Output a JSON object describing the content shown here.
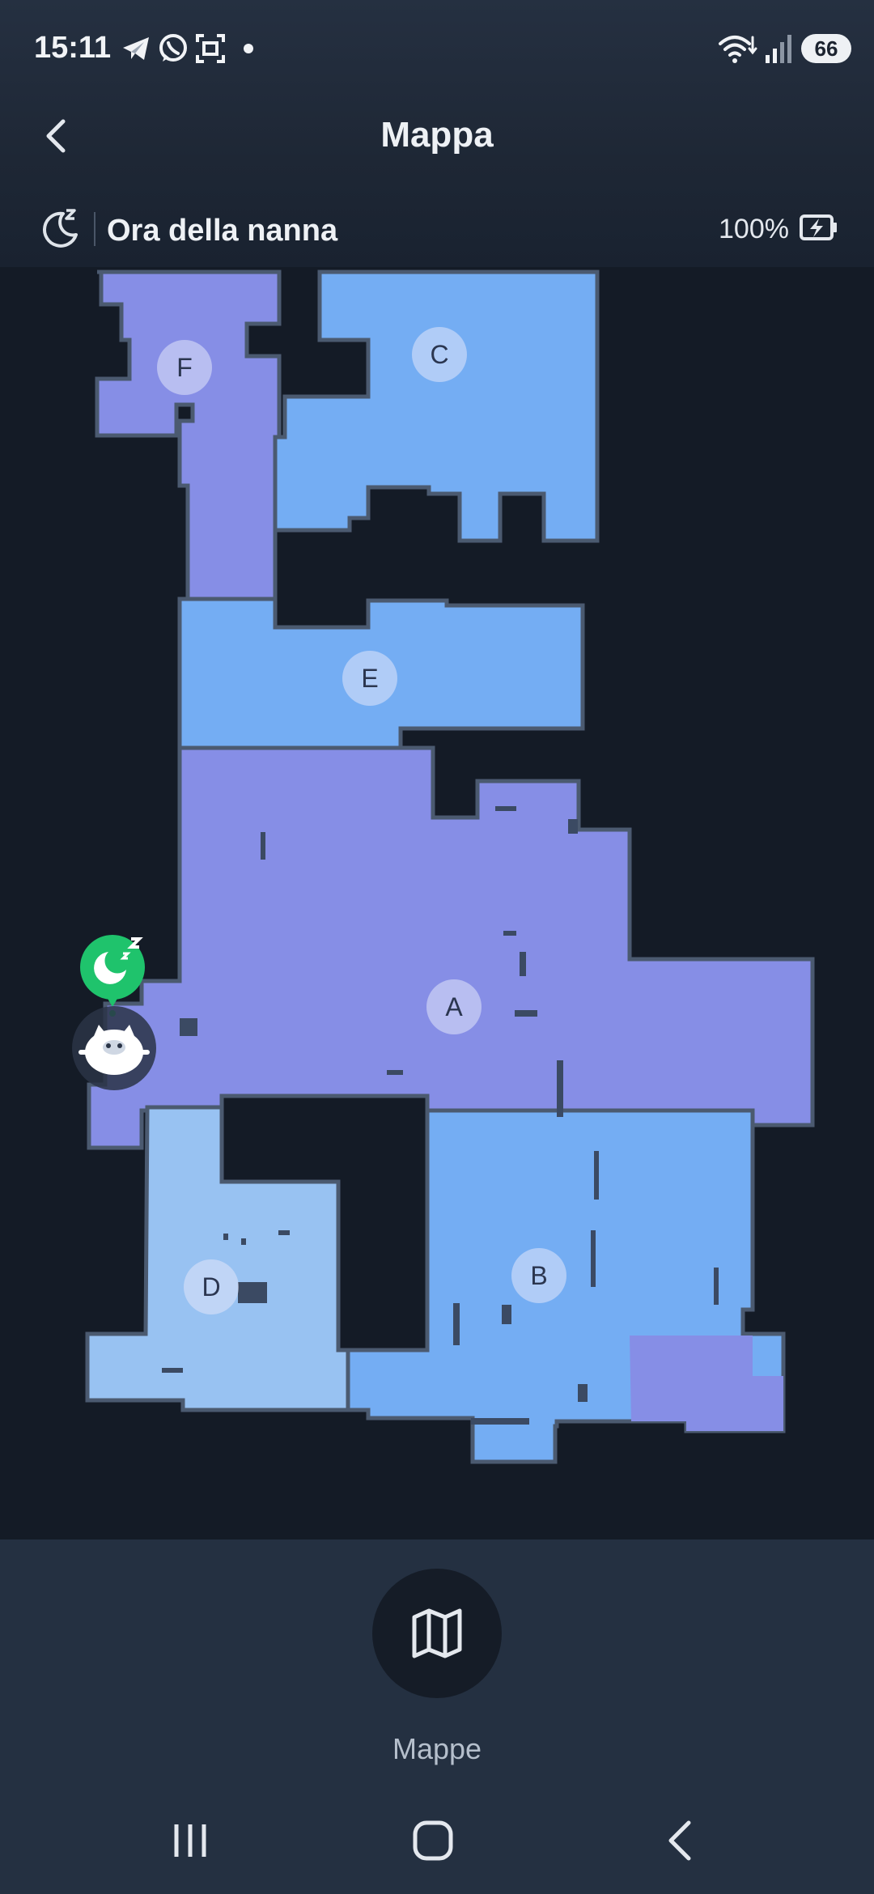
{
  "status_bar": {
    "time": "15:11",
    "battery_level": "66",
    "icons": [
      "telegram-icon",
      "whatsapp-icon",
      "screenshot-icon",
      "dot-icon",
      "wifi-icon",
      "signal-icon"
    ]
  },
  "header": {
    "title": "Mappa",
    "back_icon": "chevron-left-icon"
  },
  "mode": {
    "label": "Ora della nanna",
    "icon": "moon-z-icon",
    "battery_percent": "100%",
    "battery_icon": "battery-charging-icon"
  },
  "map": {
    "rooms": [
      {
        "label": "F",
        "color": "#868ee6"
      },
      {
        "label": "C",
        "color": "#74adf3"
      },
      {
        "label": "E",
        "color": "#74adf3"
      },
      {
        "label": "A",
        "color": "#868ee6"
      },
      {
        "label": "B",
        "color": "#74adf3"
      },
      {
        "label": "D",
        "color": "#98c2f2"
      }
    ],
    "wall_color": "#4b5a70",
    "robot_status_icon": "sleep-moon-icon",
    "robot_icon": "robot-vacuum-icon"
  },
  "bottom": {
    "maps_button_label": "Mappe",
    "maps_icon": "map-icon"
  },
  "nav": {
    "recent_icon": "recent-apps-icon",
    "home_icon": "home-icon",
    "back_icon": "back-icon"
  },
  "colors": {
    "background": "#151c27",
    "panel": "#243041",
    "accent_green": "#1fc36c"
  }
}
